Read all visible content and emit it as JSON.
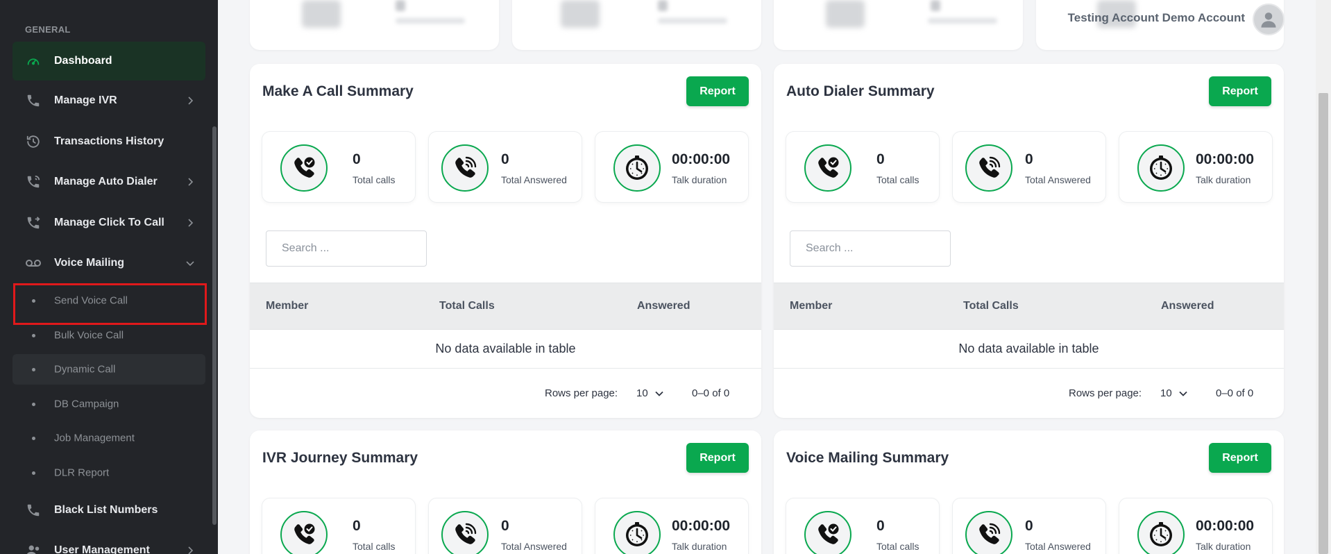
{
  "sidebar": {
    "heading": "GENERAL",
    "items": [
      {
        "label": "Dashboard",
        "icon": "speedometer-icon",
        "active": true
      },
      {
        "label": "Manage IVR",
        "icon": "phone-icon",
        "chevron": "right"
      },
      {
        "label": "Transactions History",
        "icon": "history-icon"
      },
      {
        "label": "Manage Auto Dialer",
        "icon": "phone-sync-icon",
        "chevron": "right"
      },
      {
        "label": "Manage Click To Call",
        "icon": "phone-forward-icon",
        "chevron": "right"
      },
      {
        "label": "Voice Mailing",
        "icon": "voicemail-icon",
        "chevron": "down"
      },
      {
        "label": "Black List Numbers",
        "icon": "phone-icon"
      },
      {
        "label": "User Management",
        "icon": "user-icon",
        "chevron": "right"
      }
    ],
    "subitems": [
      {
        "label": "Send Voice Call",
        "highlighted_box": true
      },
      {
        "label": "Bulk Voice Call"
      },
      {
        "label": "Dynamic Call",
        "hovered": true
      },
      {
        "label": "DB Campaign"
      },
      {
        "label": "Job Management"
      },
      {
        "label": "DLR Report"
      }
    ]
  },
  "header": {
    "user_name": "Testing Account Demo Account",
    "avatar_icon": "user-avatar-icon"
  },
  "panels": [
    {
      "title": "Make A Call Summary",
      "report_label": "Report",
      "stats": [
        {
          "value": "0",
          "caption": "Total calls",
          "icon": "phone-check-icon"
        },
        {
          "value": "0",
          "caption": "Total Answered",
          "icon": "phone-ringing-icon"
        },
        {
          "value": "00:00:00",
          "caption": "Talk duration",
          "icon": "clock-icon"
        }
      ],
      "search_placeholder": "Search ...",
      "columns": [
        "Member",
        "Total Calls",
        "Answered"
      ],
      "empty_text": "No data available in table",
      "rows_per_page_label": "Rows per page:",
      "rows_per_page_value": "10",
      "range_text": "0–0 of 0"
    },
    {
      "title": "Auto Dialer Summary",
      "report_label": "Report",
      "stats": [
        {
          "value": "0",
          "caption": "Total calls",
          "icon": "phone-check-icon"
        },
        {
          "value": "0",
          "caption": "Total Answered",
          "icon": "phone-ringing-icon"
        },
        {
          "value": "00:00:00",
          "caption": "Talk duration",
          "icon": "clock-icon"
        }
      ],
      "search_placeholder": "Search ...",
      "columns": [
        "Member",
        "Total Calls",
        "Answered"
      ],
      "empty_text": "No data available in table",
      "rows_per_page_label": "Rows per page:",
      "rows_per_page_value": "10",
      "range_text": "0–0 of 0"
    },
    {
      "title": "IVR Journey Summary",
      "report_label": "Report",
      "stats": [
        {
          "value": "0",
          "caption": "Total calls",
          "icon": "phone-check-icon"
        },
        {
          "value": "0",
          "caption": "Total Answered",
          "icon": "phone-ringing-icon"
        },
        {
          "value": "00:00:00",
          "caption": "Talk duration",
          "icon": "clock-icon"
        }
      ]
    },
    {
      "title": "Voice Mailing Summary",
      "report_label": "Report",
      "stats": [
        {
          "value": "0",
          "caption": "Total calls",
          "icon": "phone-check-icon"
        },
        {
          "value": "0",
          "caption": "Total Answered",
          "icon": "phone-ringing-icon"
        },
        {
          "value": "00:00:00",
          "caption": "Talk duration",
          "icon": "clock-icon"
        }
      ]
    }
  ],
  "colors": {
    "sidebar_bg": "#232529",
    "accent_green": "#0aa84f",
    "highlight_red": "#e0191b",
    "content_bg": "#f4f5f7"
  }
}
